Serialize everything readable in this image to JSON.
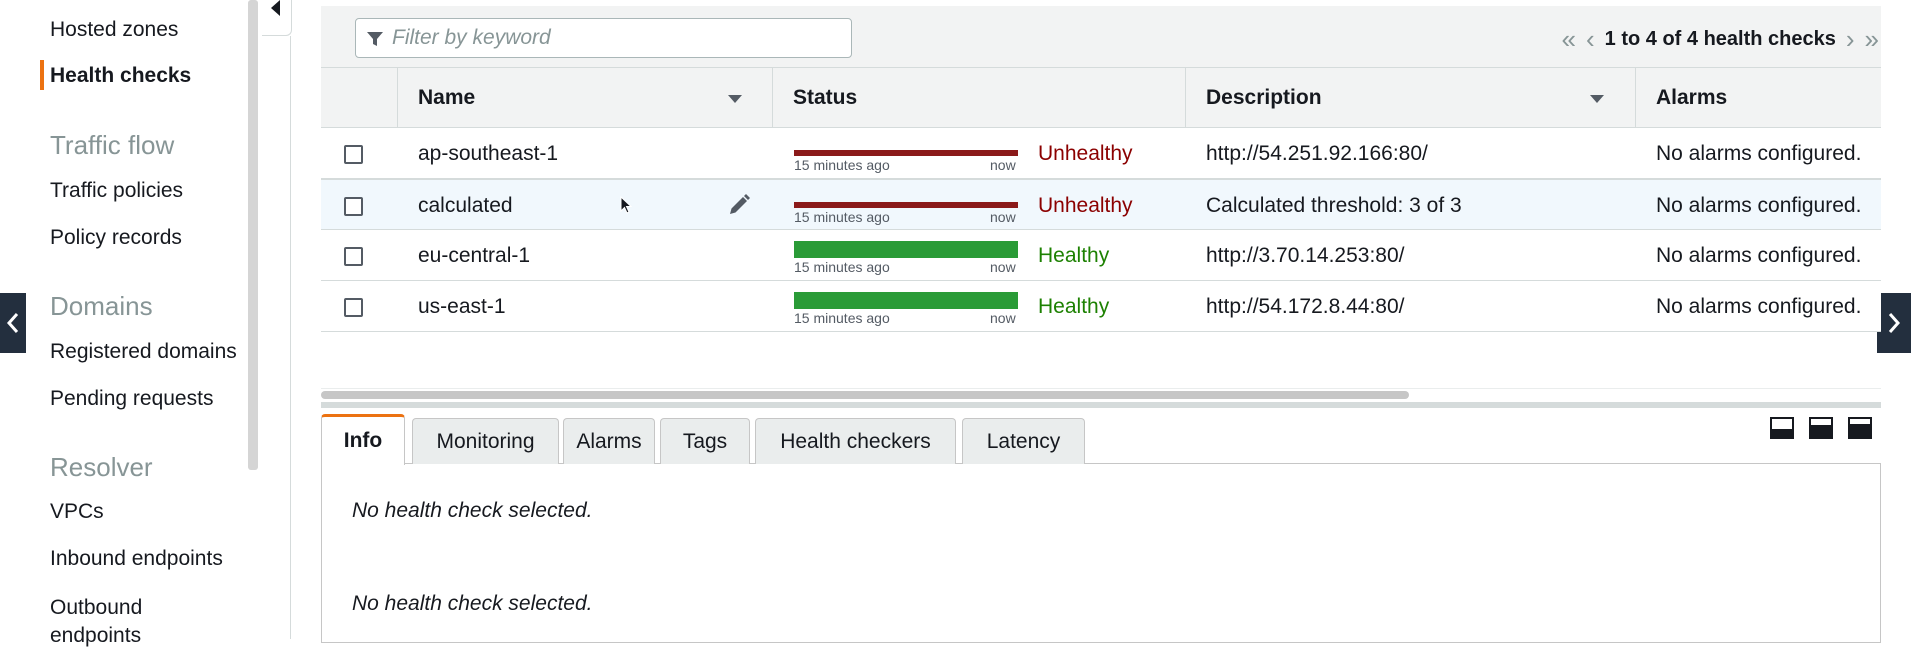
{
  "sidebar": {
    "items_top": [
      {
        "label": "Hosted zones"
      },
      {
        "label": "Health checks"
      }
    ],
    "sections": [
      {
        "title": "Traffic flow",
        "items": [
          "Traffic policies",
          "Policy records"
        ]
      },
      {
        "title": "Domains",
        "items": [
          "Registered domains",
          "Pending requests"
        ]
      },
      {
        "title": "Resolver",
        "items": [
          "VPCs",
          "Inbound endpoints",
          "Outbound endpoints"
        ]
      }
    ]
  },
  "toolbar": {
    "filter_placeholder": "Filter by keyword",
    "pager_label": "1 to 4 of 4 health checks"
  },
  "table": {
    "columns": [
      "Name",
      "Status",
      "Description",
      "Alarms"
    ],
    "bar_left_label": "15 minutes ago",
    "bar_right_label": "now",
    "rows": [
      {
        "name": "ap-southeast-1",
        "status": "Unhealthy",
        "description": "http://54.251.92.166:80/",
        "alarms": "No alarms configured."
      },
      {
        "name": "calculated",
        "status": "Unhealthy",
        "description": "Calculated threshold: 3 of 3",
        "alarms": "No alarms configured."
      },
      {
        "name": "eu-central-1",
        "status": "Healthy",
        "description": "http://3.70.14.253:80/",
        "alarms": "No alarms configured."
      },
      {
        "name": "us-east-1",
        "status": "Healthy",
        "description": "http://54.172.8.44:80/",
        "alarms": "No alarms configured."
      }
    ]
  },
  "detail": {
    "tabs": [
      "Info",
      "Monitoring",
      "Alarms",
      "Tags",
      "Health checkers",
      "Latency"
    ],
    "messages": [
      "No health check selected.",
      "No health check selected."
    ]
  },
  "colors": {
    "accent": "#ec7211",
    "unhealthy": "#8b0000",
    "healthy": "#1d8102",
    "nav_dark": "#232f3e"
  }
}
